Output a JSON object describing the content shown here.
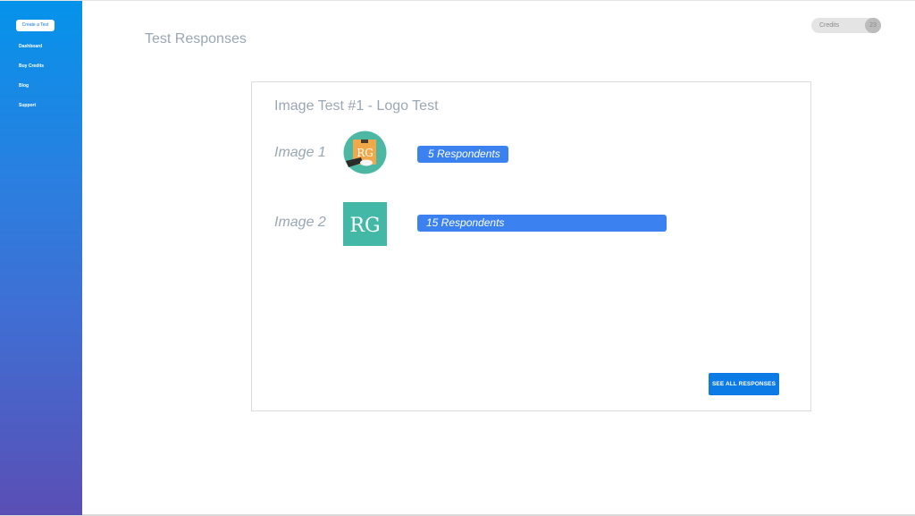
{
  "sidebar": {
    "create_button": "Create a Test",
    "items": [
      {
        "label": "Dashboard"
      },
      {
        "label": "Buy Credits"
      },
      {
        "label": "Blog"
      },
      {
        "label": "Support"
      }
    ]
  },
  "header": {
    "title": "Test Responses",
    "credits_label": "Credits",
    "credits_count": "23"
  },
  "test_card": {
    "title": "Image Test #1 - Logo Test",
    "rows": [
      {
        "label": "Image 1",
        "logo_text": "RG",
        "respondents": 5,
        "respondents_label": "5 Respondents",
        "logo_colors": {
          "circle": "#4cb8a4",
          "box": "#f0a849"
        }
      },
      {
        "label": "Image 2",
        "logo_text": "RG",
        "respondents": 15,
        "respondents_label": "15 Respondents",
        "logo_colors": {
          "square": "#44b8a6"
        }
      }
    ],
    "see_all_button": "SEE ALL RESPONSES"
  },
  "colors": {
    "sidebar_top": "#0593ea",
    "sidebar_bottom": "#5a4fb5",
    "bar": "#3b82f0",
    "button": "#0d7be6",
    "muted_text": "#9aa7b4"
  }
}
